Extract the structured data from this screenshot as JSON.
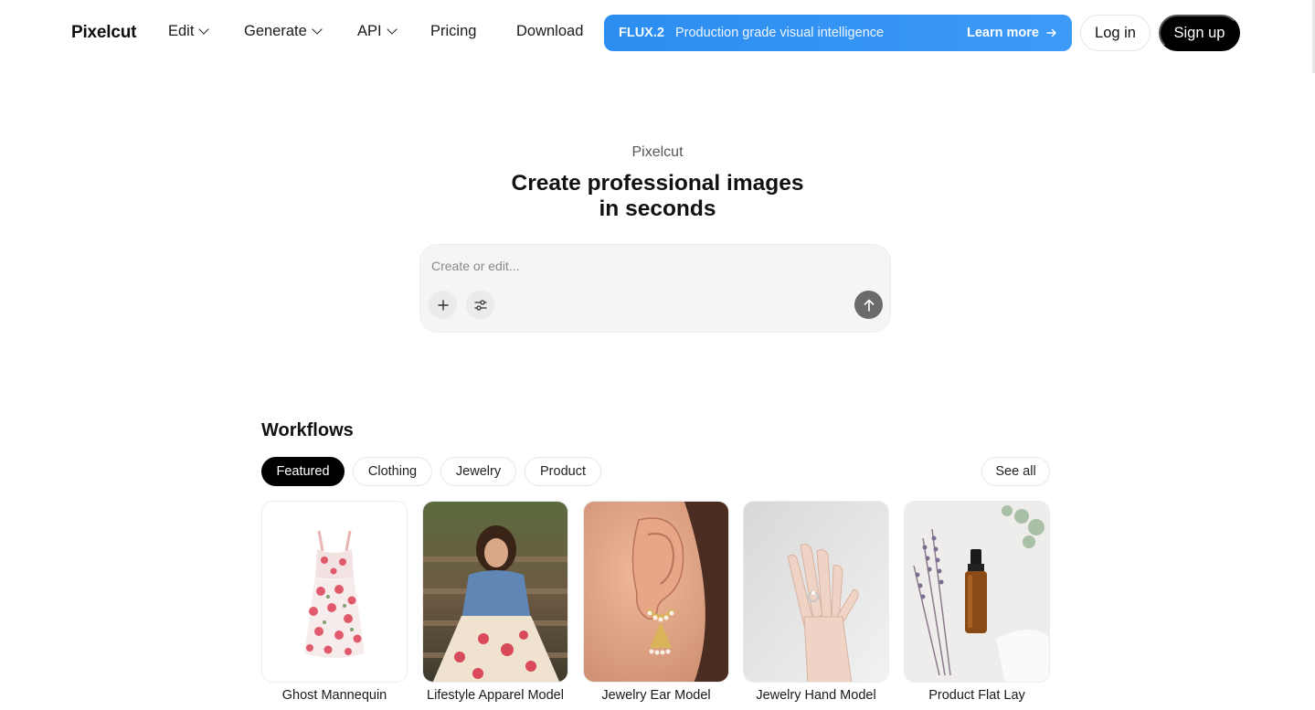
{
  "nav": {
    "logo": "Pixelcut",
    "items": [
      {
        "label": "Edit",
        "dropdown": true
      },
      {
        "label": "Generate",
        "dropdown": true
      },
      {
        "label": "API",
        "dropdown": true
      },
      {
        "label": "Pricing",
        "dropdown": false
      },
      {
        "label": "Download",
        "dropdown": false
      }
    ],
    "banner": {
      "tag": "FLUX.2",
      "text": "Production grade visual intelligence",
      "cta": "Learn more",
      "color": "#3393f4"
    },
    "login": "Log in",
    "signup": "Sign up"
  },
  "hero": {
    "eyebrow": "Pixelcut",
    "headline_line1": "Create professional images",
    "headline_line2": "in seconds",
    "prompt_placeholder": "Create or edit..."
  },
  "workflows": {
    "title": "Workflows",
    "tabs": [
      {
        "label": "Featured",
        "active": true
      },
      {
        "label": "Clothing",
        "active": false
      },
      {
        "label": "Jewelry",
        "active": false
      },
      {
        "label": "Product",
        "active": false
      }
    ],
    "see_all": "See all",
    "cards": [
      {
        "label": "Ghost Mannequin",
        "image": "floral-dress"
      },
      {
        "label": "Lifestyle Apparel Model",
        "image": "woman-denim-jacket-floral-skirt"
      },
      {
        "label": "Jewelry Ear Model",
        "image": "ear-with-gold-pearl-earring"
      },
      {
        "label": "Jewelry Hand Model",
        "image": "hand-with-ring"
      },
      {
        "label": "Product Flat Lay",
        "image": "amber-dropper-bottle-lavender"
      }
    ]
  }
}
